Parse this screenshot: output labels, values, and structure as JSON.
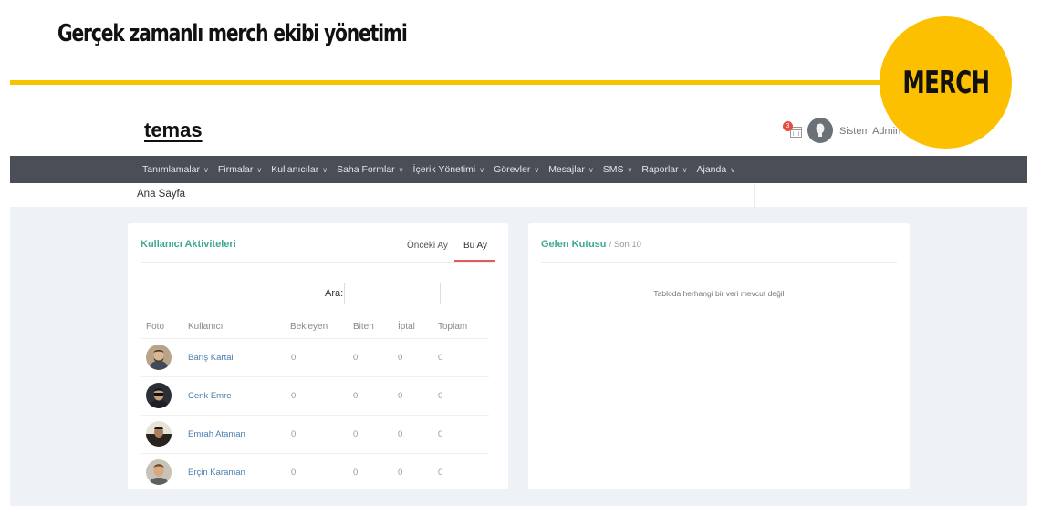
{
  "slide": {
    "title": "Gerçek zamanlı merch ekibi yönetimi",
    "badge": "MERCH",
    "accent_color": "#fcc000"
  },
  "header": {
    "logo": "temas",
    "notification_count": "3",
    "user_name": "Sistem Admin"
  },
  "nav": {
    "items": [
      {
        "label": "Tanımlamalar"
      },
      {
        "label": "Firmalar"
      },
      {
        "label": "Kullanıcılar"
      },
      {
        "label": "Saha Formlar"
      },
      {
        "label": "İçerik Yönetimi"
      },
      {
        "label": "Görevler"
      },
      {
        "label": "Mesajlar"
      },
      {
        "label": "SMS"
      },
      {
        "label": "Raporlar"
      },
      {
        "label": "Ajanda"
      }
    ]
  },
  "breadcrumb": "Ana Sayfa",
  "activities": {
    "title": "Kullanıcı Aktiviteleri",
    "tabs": [
      "Önceki Ay",
      "Bu Ay"
    ],
    "active_tab": "Bu Ay",
    "search_label": "Ara:",
    "search_value": "",
    "columns": [
      "Foto",
      "Kullanıcı",
      "Bekleyen",
      "Biten",
      "İptal",
      "Toplam"
    ],
    "rows": [
      {
        "name": "Barış Kartal",
        "bekleyen": "0",
        "biten": "0",
        "iptal": "0",
        "toplam": "0"
      },
      {
        "name": "Cenk Emre",
        "bekleyen": "0",
        "biten": "0",
        "iptal": "0",
        "toplam": "0"
      },
      {
        "name": "Emrah Ataman",
        "bekleyen": "0",
        "biten": "0",
        "iptal": "0",
        "toplam": "0"
      },
      {
        "name": "Erçin Karaman",
        "bekleyen": "0",
        "biten": "0",
        "iptal": "0",
        "toplam": "0"
      }
    ]
  },
  "inbox": {
    "title": "Gelen Kutusu",
    "subtitle": "/ Son 10",
    "empty_message": "Tabloda herhangi bir veri mevcut değil"
  }
}
